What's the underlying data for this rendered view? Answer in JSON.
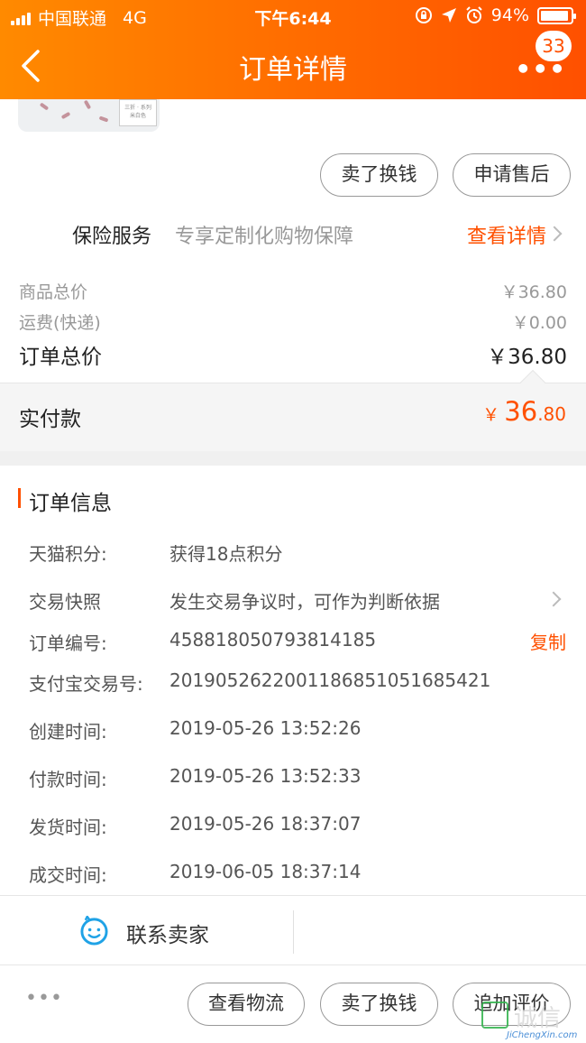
{
  "status_bar": {
    "carrier": "中国联通",
    "network": "4G",
    "time": "下午6:44",
    "battery": "94%",
    "battery_level": 0.94
  },
  "nav": {
    "title": "订单详情",
    "badge_count": "33",
    "more_glyph": "•••"
  },
  "product_actions": {
    "sell_button": "卖了换钱",
    "after_sale_button": "申请售后"
  },
  "insurance": {
    "label": "保险服务",
    "description": "专享定制化购物保障",
    "link": "查看详情"
  },
  "prices": {
    "goods_total_label": "商品总价",
    "goods_total_value": "￥36.80",
    "shipping_label": "运费(快递)",
    "shipping_value": "￥0.00",
    "order_total_label": "订单总价",
    "order_total_value": "￥36.80",
    "paid_label": "实付款",
    "paid_currency": "￥",
    "paid_integer": "36",
    "paid_decimal": ".80"
  },
  "order_info": {
    "section_title": "订单信息",
    "points_label": "天猫积分:",
    "points_value": "获得18点积分",
    "snapshot_label": "交易快照",
    "snapshot_value": "发生交易争议时，可作为判断依据",
    "order_no_label": "订单编号:",
    "order_no_value": "458818050793814185",
    "copy_button": "复制",
    "alipay_label": "支付宝交易号:",
    "alipay_value": "2019052622001186851051685421",
    "created_label": "创建时间:",
    "created_value": "2019-05-26 13:52:26",
    "paid_time_label": "付款时间:",
    "paid_time_value": "2019-05-26 13:52:33",
    "shipped_label": "发货时间:",
    "shipped_value": "2019-05-26 18:37:07",
    "completed_label": "成交时间:",
    "completed_value": "2019-06-05 18:37:14"
  },
  "contact": {
    "label": "联系卖家"
  },
  "bottom_bar": {
    "more_glyph": "•••",
    "logistics_button": "查看物流",
    "sell_button": "卖了换钱",
    "review_button": "追加评价"
  },
  "watermark": {
    "text": "诚信",
    "url": "JiChengXin.com"
  },
  "colors": {
    "accent": "#ff5000",
    "header_start": "#ff8a00",
    "header_end": "#ff5000",
    "contact_icon": "#1fa2e6"
  }
}
